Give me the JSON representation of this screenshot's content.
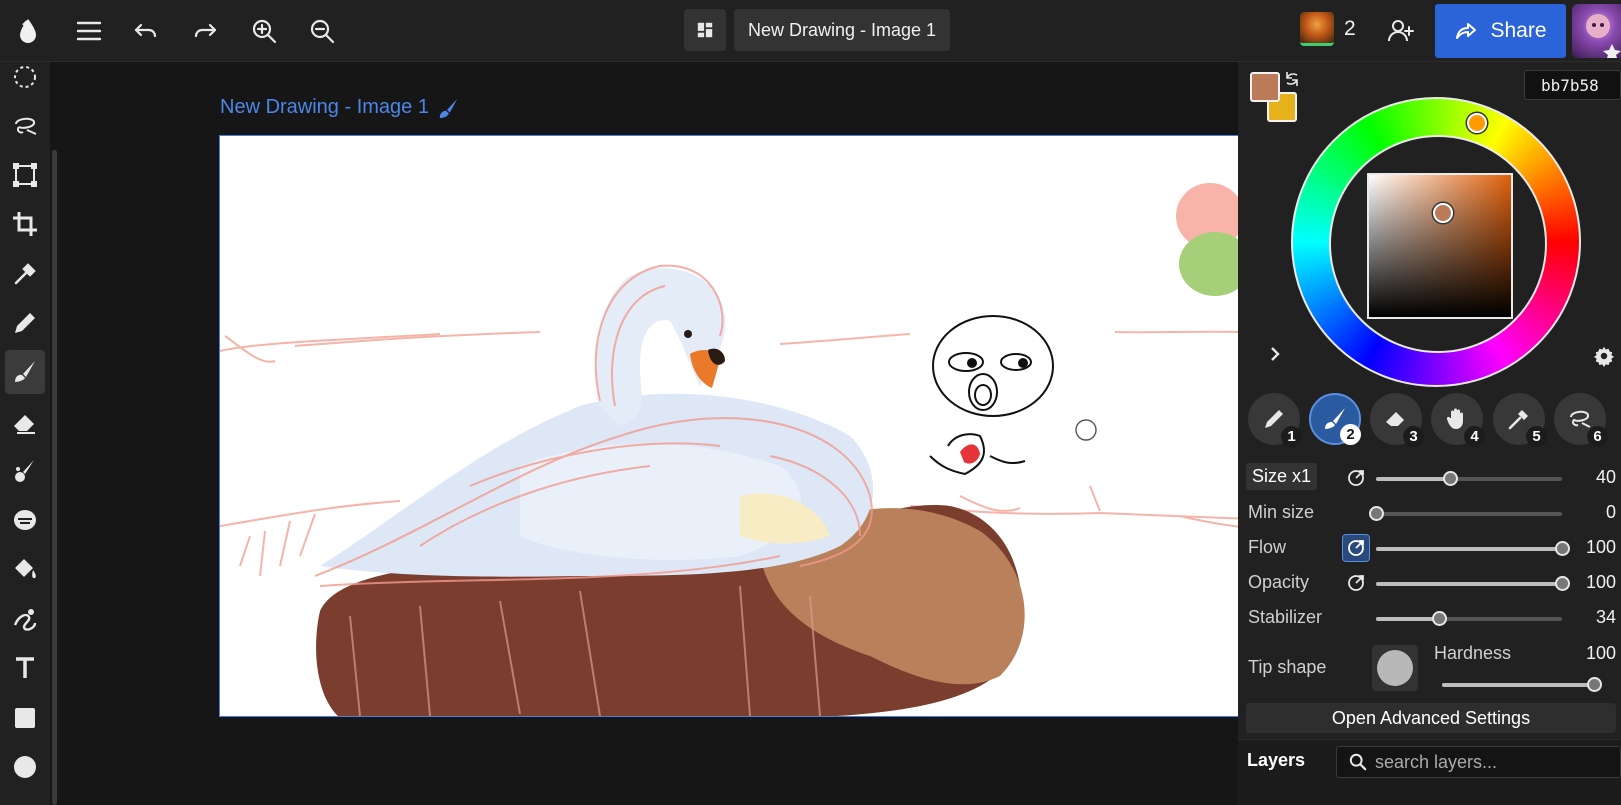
{
  "topbar": {
    "doc_title": "New Drawing - Image 1",
    "collaborator_count": "2",
    "share_label": "Share"
  },
  "canvas": {
    "document_label": "New Drawing - Image 1"
  },
  "colors": {
    "primary": "#bb7b58",
    "secondary": "#e5b21b",
    "accent": "#2a64d8",
    "link": "#4c86e8"
  },
  "color_panel": {
    "hex_value": "bb7b58"
  },
  "brushes": [
    {
      "icon": "pencil-icon",
      "number": "1"
    },
    {
      "icon": "brush-icon",
      "number": "2",
      "active": true
    },
    {
      "icon": "eraser-icon",
      "number": "3"
    },
    {
      "icon": "hand-icon",
      "number": "4"
    },
    {
      "icon": "eyedropper-icon",
      "number": "5"
    },
    {
      "icon": "lasso-icon",
      "number": "6"
    }
  ],
  "brush_props": {
    "size": {
      "label": "Size x1",
      "value": "40",
      "fraction": 0.4
    },
    "min_size": {
      "label": "Min size",
      "value": "0",
      "fraction": 0.0
    },
    "flow": {
      "label": "Flow",
      "value": "100",
      "fraction": 1.0
    },
    "opacity": {
      "label": "Opacity",
      "value": "100",
      "fraction": 1.0
    },
    "stabilizer": {
      "label": "Stabilizer",
      "value": "34",
      "fraction": 0.34
    },
    "tip_shape_label": "Tip shape",
    "hardness": {
      "label": "Hardness",
      "value": "100",
      "fraction": 1.0
    },
    "advanced_label": "Open Advanced Settings"
  },
  "layers": {
    "title": "Layers",
    "search_placeholder": "search layers..."
  },
  "left_tools": [
    "select-ellipse-icon",
    "lasso-icon",
    "transform-icon",
    "crop-icon",
    "eyedropper-icon",
    "pencil-icon",
    "brush-icon",
    "eraser-icon",
    "smudge-icon",
    "blur-icon",
    "fill-bucket-icon",
    "liquify-icon",
    "text-icon",
    "rectangle-icon",
    "ellipse-icon"
  ]
}
